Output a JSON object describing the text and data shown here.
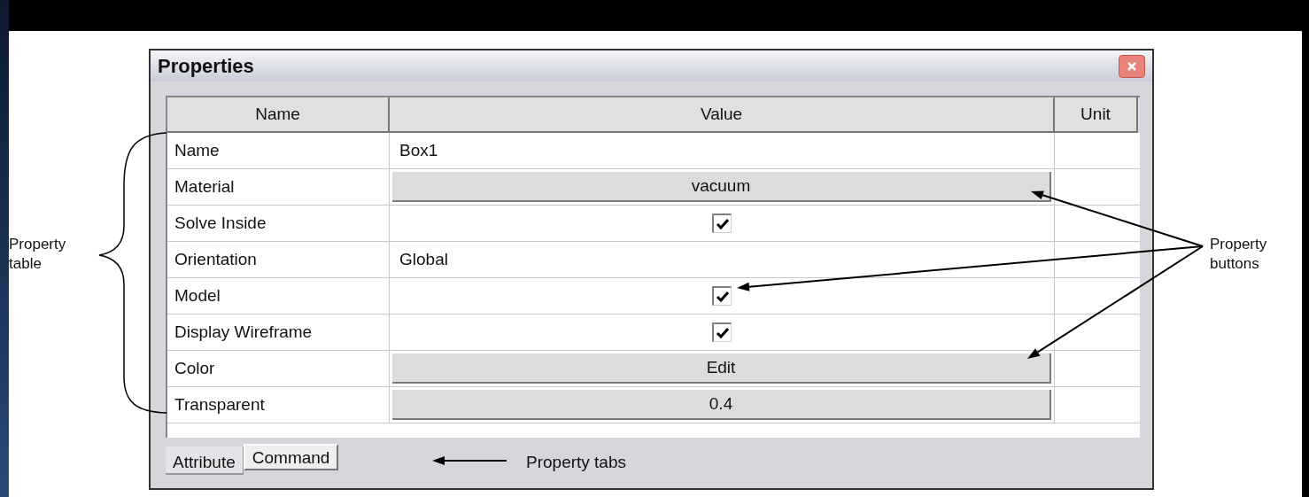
{
  "window": {
    "title": "Properties"
  },
  "table": {
    "columns": [
      "Name",
      "Value",
      "Unit"
    ],
    "rows": [
      {
        "name": "Name",
        "kind": "text",
        "value": "Box1"
      },
      {
        "name": "Material",
        "kind": "button",
        "value": "vacuum"
      },
      {
        "name": "Solve Inside",
        "kind": "checkbox",
        "checked": true
      },
      {
        "name": "Orientation",
        "kind": "text",
        "value": "Global"
      },
      {
        "name": "Model",
        "kind": "checkbox",
        "checked": true
      },
      {
        "name": "Display Wireframe",
        "kind": "checkbox",
        "checked": true
      },
      {
        "name": "Color",
        "kind": "button",
        "value": "Edit"
      },
      {
        "name": "Transparent",
        "kind": "button",
        "value": "0.4"
      }
    ]
  },
  "tabs": [
    {
      "label": "Attribute",
      "selected": true
    },
    {
      "label": "Command",
      "selected": false
    }
  ],
  "annotations": [
    {
      "text": "Property table"
    },
    {
      "text": "Property buttons"
    },
    {
      "text": "Property tabs"
    }
  ]
}
